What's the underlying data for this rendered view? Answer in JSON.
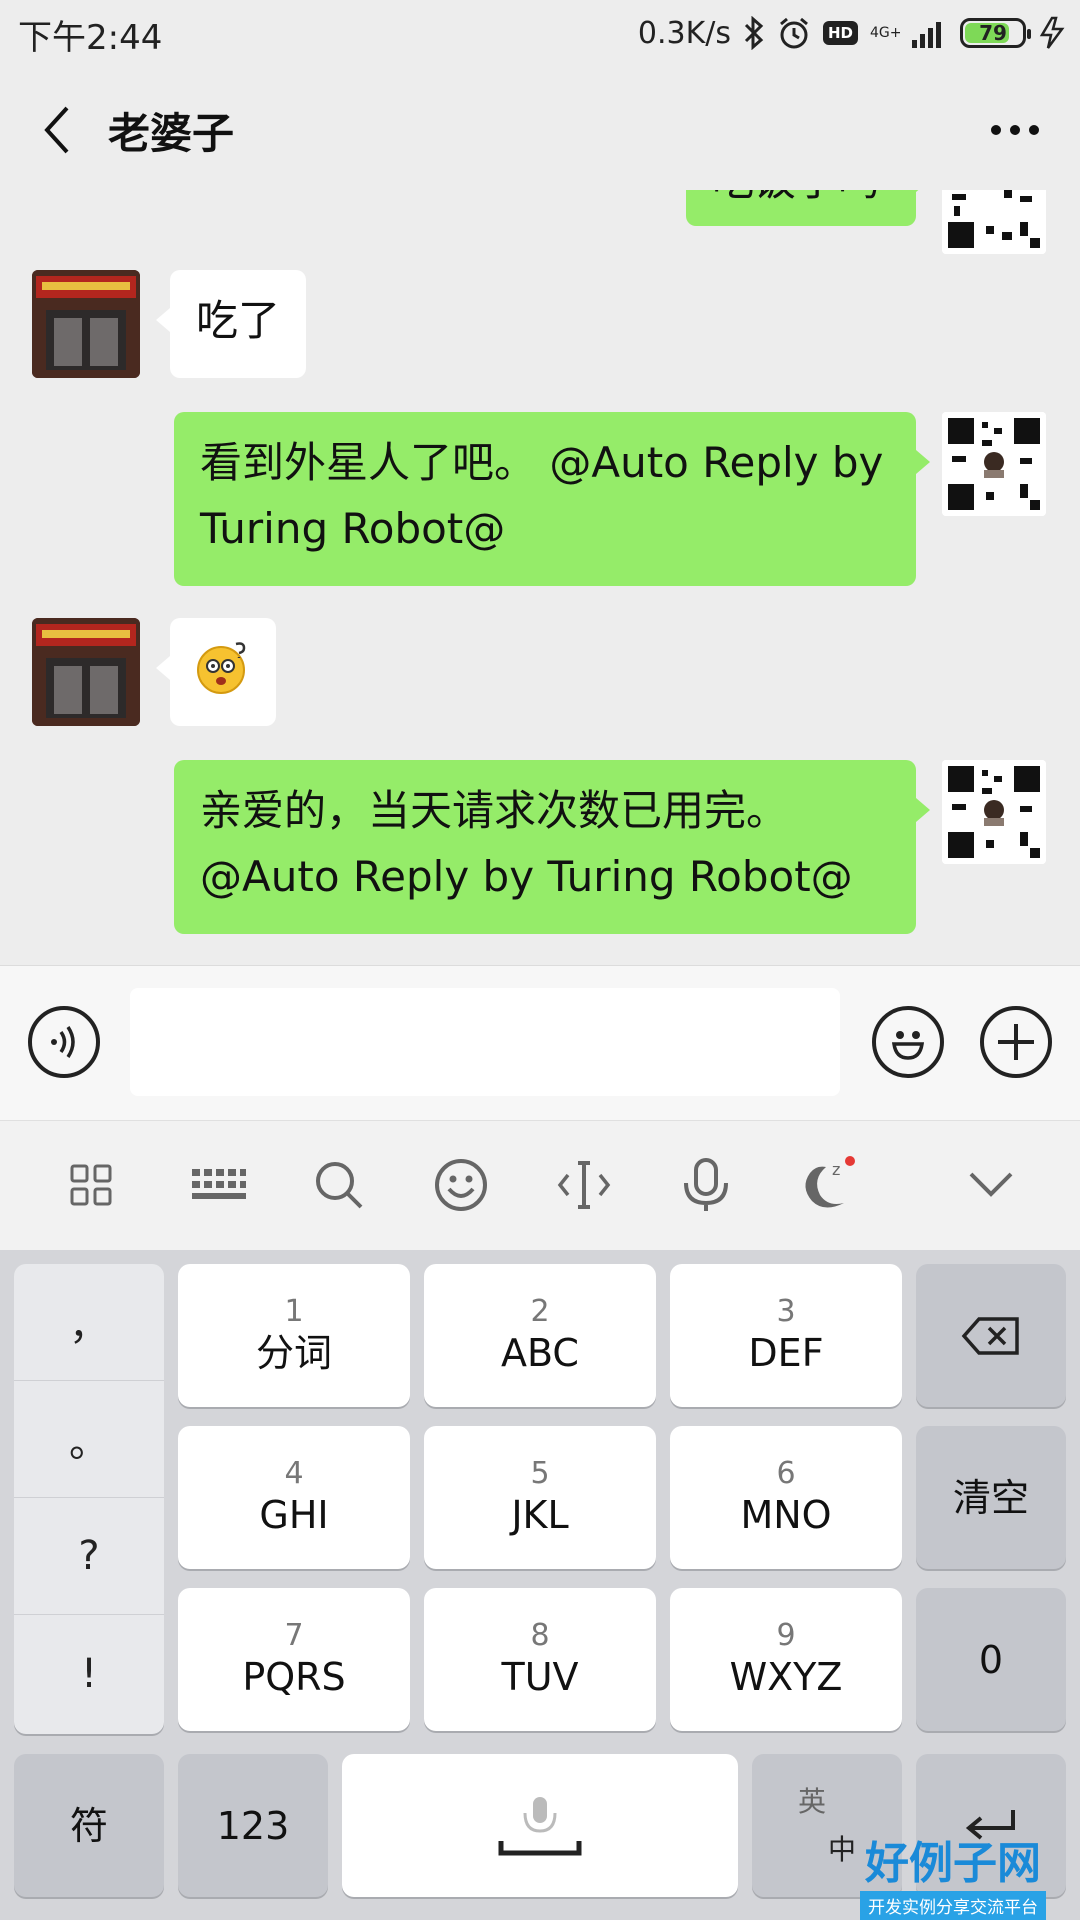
{
  "status_bar": {
    "time": "下午2:44",
    "speed": "0.3K/s",
    "hd": "HD",
    "network": "4G+",
    "battery": "79",
    "battery_level": 0.79
  },
  "header": {
    "title": "老婆子"
  },
  "messages": [
    {
      "direction": "out",
      "text": "吃饭了吗"
    },
    {
      "direction": "in",
      "text": "吃了"
    },
    {
      "direction": "out",
      "text": "看到外星人了吧。 @Auto Reply by Turing Robot@"
    },
    {
      "direction": "in",
      "emoji": "dizzy-face-sticker"
    },
    {
      "direction": "out",
      "text": "亲爱的，当天请求次数已用完。 @Auto Reply by Turing Robot@"
    }
  ],
  "input": {
    "value": ""
  },
  "keyboard": {
    "punctuation": [
      "，",
      "。",
      "?",
      "!"
    ],
    "rows": [
      [
        {
          "num": "1",
          "label": "分词"
        },
        {
          "num": "2",
          "label": "ABC"
        },
        {
          "num": "3",
          "label": "DEF"
        }
      ],
      [
        {
          "num": "4",
          "label": "GHI"
        },
        {
          "num": "5",
          "label": "JKL"
        },
        {
          "num": "6",
          "label": "MNO"
        }
      ],
      [
        {
          "num": "7",
          "label": "PQRS"
        },
        {
          "num": "8",
          "label": "TUV"
        },
        {
          "num": "9",
          "label": "WXYZ"
        }
      ]
    ],
    "clear": "清空",
    "zero": "0",
    "symbol": "符",
    "numbers": "123",
    "lang_top": "英",
    "lang_bottom": "中"
  },
  "watermark": {
    "title": "好例子网",
    "subtitle": "开发实例分享交流平台"
  },
  "colors": {
    "outgoing_bubble": "#95ec69",
    "incoming_bubble": "#ffffff",
    "background": "#ededed"
  }
}
